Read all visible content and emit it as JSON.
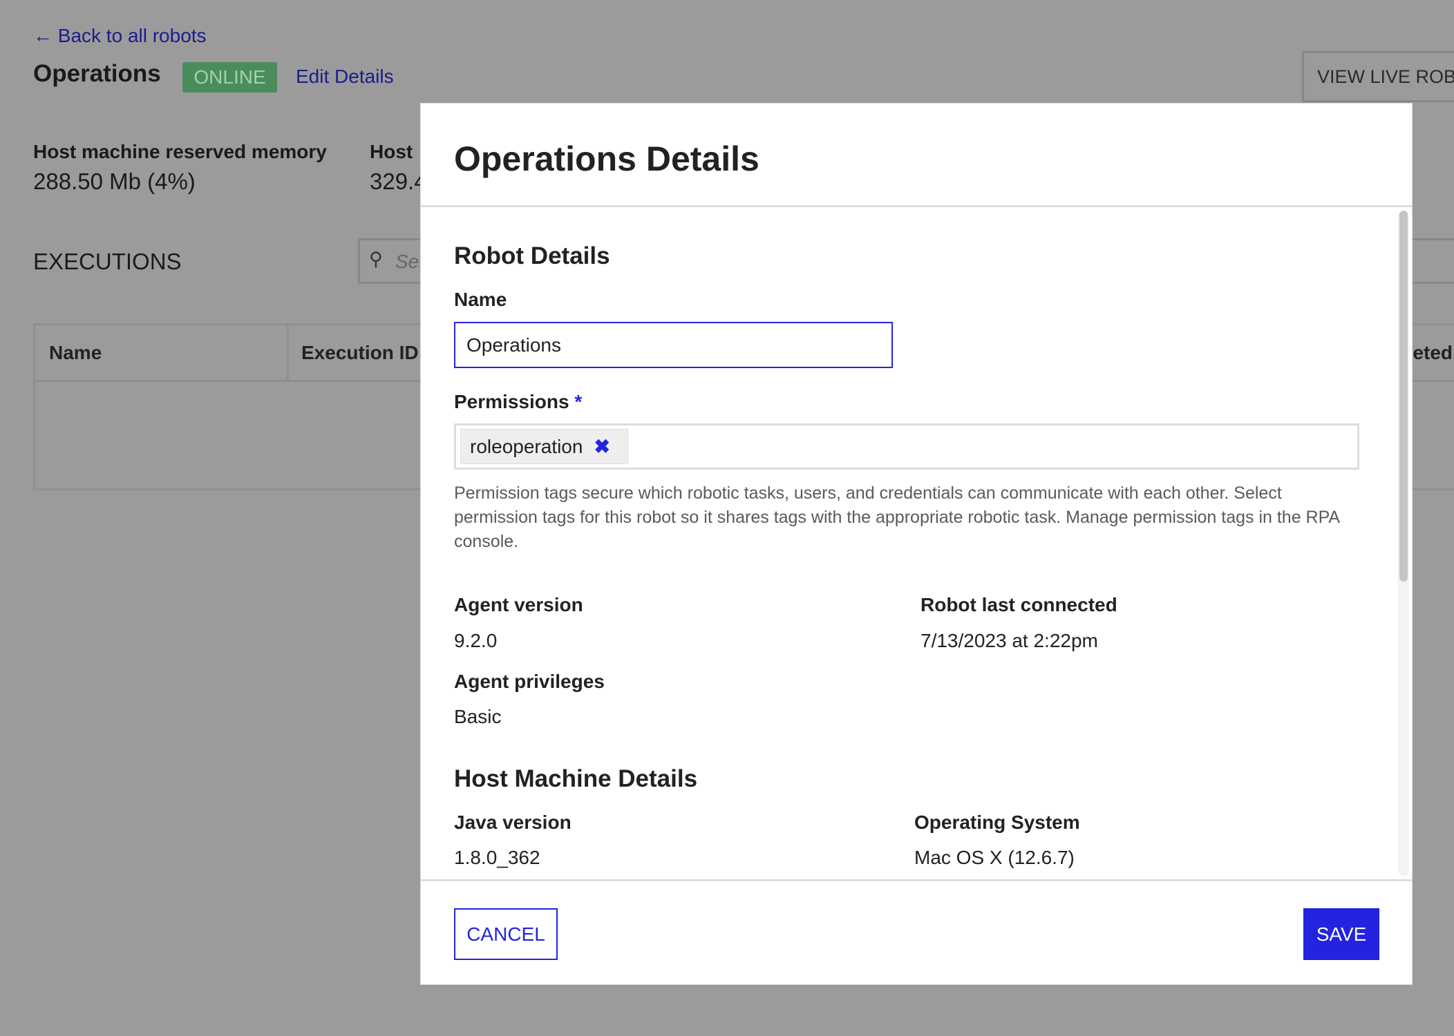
{
  "page": {
    "back_link": "Back to all robots",
    "robot_name": "Operations",
    "status_badge": "ONLINE",
    "edit_link": "Edit Details",
    "view_live_button": "VIEW LIVE ROB",
    "stats": [
      {
        "label": "Host machine reserved memory",
        "value": "288.50 Mb (4%)"
      },
      {
        "label": "Host",
        "value": "329.4"
      }
    ],
    "executions_title": "EXECUTIONS",
    "search_placeholder": "Se",
    "table_headers": [
      "Name",
      "Execution ID",
      "eted"
    ]
  },
  "modal": {
    "title": "Operations Details",
    "robot_section": "Robot Details",
    "name_label": "Name",
    "name_value": "Operations",
    "permissions_label": "Permissions",
    "required_mark": "*",
    "permission_tags": [
      "roleoperation"
    ],
    "permissions_help": "Permission tags secure which robotic tasks, users, and credentials can communicate with each other. Select permission tags for this robot so it shares tags with the appropriate robotic task. Manage permission tags in the RPA console.",
    "agent_version_label": "Agent version",
    "agent_version": "9.2.0",
    "last_connected_label": "Robot last connected",
    "last_connected": "7/13/2023 at 2:22pm",
    "privileges_label": "Agent privileges",
    "privileges": "Basic",
    "host_section": "Host Machine Details",
    "java_label": "Java version",
    "java_version": "1.8.0_362",
    "os_label": "Operating System",
    "os_value": "Mac OS X (12.6.7)",
    "cancel_label": "CANCEL",
    "save_label": "SAVE"
  },
  "colors": {
    "accent": "#2323e0",
    "online": "#4a8c5c",
    "overlay": "#9b9b9b"
  }
}
